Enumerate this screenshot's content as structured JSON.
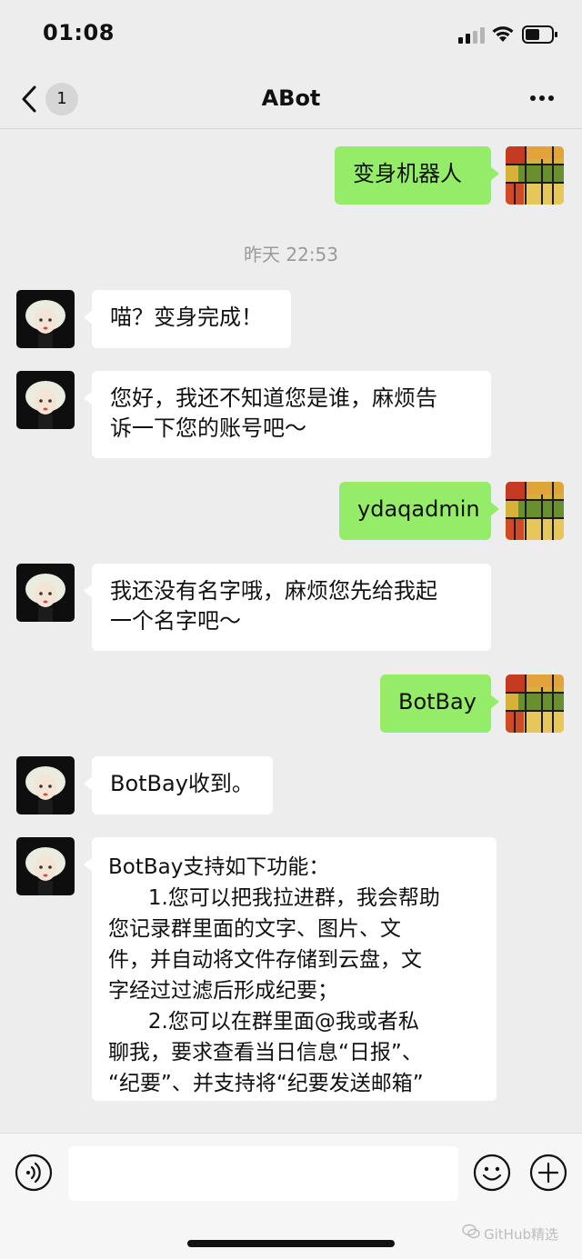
{
  "status_bar": {
    "time": "01:08"
  },
  "header": {
    "back_badge": "1",
    "title": "ABot"
  },
  "timestamp": "昨天 22:53",
  "messages": {
    "m1": "变身机器人",
    "m2": "喵？变身完成！",
    "m3": "您好，我还不知道您是谁，麻烦告\n诉一下您的账号吧～",
    "m4": "ydaqadmin",
    "m5": "我还没有名字哦，麻烦您先给我起\n一个名字吧～",
    "m6": "BotBay",
    "m7": "BotBay收到。",
    "m8": "BotBay支持如下功能：\n      1.您可以把我拉进群，我会帮助\n您记录群里面的文字、图片、文\n件，并自动将文件存储到云盘，文\n字经过过滤后形成纪要；\n      2.您可以在群里面@我或者私\n聊我，要求查看当日信息“日报”、\n“纪要”、并支持将“纪要发送邮箱”"
  },
  "input": {
    "value": "",
    "placeholder": ""
  },
  "watermark": "GitHub精选",
  "colors": {
    "sent_bubble": "#95ec69",
    "received_bubble": "#ffffff",
    "background": "#ededed"
  },
  "icons": [
    "back-icon",
    "more-icon",
    "voice-icon",
    "emoji-icon",
    "plus-icon",
    "wechat-icon"
  ]
}
